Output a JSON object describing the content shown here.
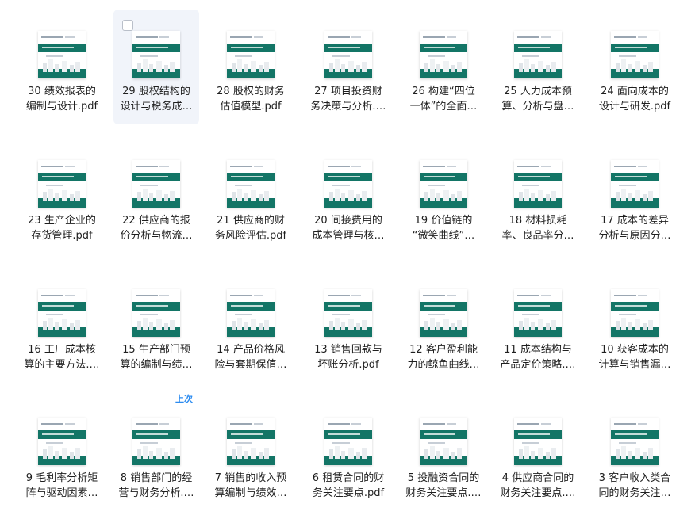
{
  "files": [
    {
      "line1": "30 绩效报表的",
      "line2": "编制与设计.pdf",
      "icon": "pdf-thumbnail-icon"
    },
    {
      "line1": "29 股权结构的",
      "line2": "设计与税务成…",
      "icon": "pdf-thumbnail-icon"
    },
    {
      "line1": "28 股权的财务",
      "line2": "估值模型.pdf",
      "icon": "pdf-thumbnail-icon"
    },
    {
      "line1": "27 项目投资财",
      "line2": "务决策与分析.…",
      "icon": "pdf-thumbnail-icon"
    },
    {
      "line1": "26 构建“四位",
      "line2": "一体”的全面…",
      "icon": "pdf-thumbnail-icon"
    },
    {
      "line1": "25 人力成本预",
      "line2": "算、分析与盘…",
      "icon": "pdf-thumbnail-icon"
    },
    {
      "line1": "24 面向成本的",
      "line2": "设计与研发.pdf",
      "icon": "pdf-thumbnail-icon"
    },
    {
      "line1": "23 生产企业的",
      "line2": "存货管理.pdf",
      "icon": "pdf-thumbnail-icon"
    },
    {
      "line1": "22 供应商的报",
      "line2": "价分析与物流…",
      "icon": "pdf-thumbnail-icon"
    },
    {
      "line1": "21 供应商的财",
      "line2": "务风险评估.pdf",
      "icon": "pdf-thumbnail-icon"
    },
    {
      "line1": "20 间接费用的",
      "line2": "成本管理与核…",
      "icon": "pdf-thumbnail-icon"
    },
    {
      "line1": "19 价值链的",
      "line2": "“微笑曲线”…",
      "icon": "pdf-thumbnail-icon"
    },
    {
      "line1": "18 材料损耗",
      "line2": "率、良品率分…",
      "icon": "pdf-thumbnail-icon"
    },
    {
      "line1": "17 成本的差异",
      "line2": "分析与原因分…",
      "icon": "pdf-thumbnail-icon"
    },
    {
      "line1": "16 工厂成本核",
      "line2": "算的主要方法.…",
      "icon": "pdf-thumbnail-icon"
    },
    {
      "line1": "15 生产部门预",
      "line2": "算的编制与绩…",
      "icon": "pdf-thumbnail-icon"
    },
    {
      "line1": "14 产品价格风",
      "line2": "险与套期保值…",
      "icon": "pdf-thumbnail-icon"
    },
    {
      "line1": "13 销售回款与",
      "line2": "坏账分析.pdf",
      "icon": "pdf-thumbnail-icon"
    },
    {
      "line1": "12 客户盈利能",
      "line2": "力的鲸鱼曲线…",
      "icon": "pdf-thumbnail-icon"
    },
    {
      "line1": "11 成本结构与",
      "line2": "产品定价策略.…",
      "icon": "pdf-thumbnail-icon"
    },
    {
      "line1": "10 获客成本的",
      "line2": "计算与销售漏…",
      "icon": "pdf-thumbnail-icon"
    },
    {
      "line1": "9 毛利率分析矩",
      "line2": "阵与驱动因素…",
      "icon": "pdf-thumbnail-icon"
    },
    {
      "line1": "8 销售部门的经",
      "line2": "营与财务分析.…",
      "icon": "pdf-thumbnail-icon"
    },
    {
      "line1": "7 销售的收入预",
      "line2": "算编制与绩效…",
      "icon": "pdf-thumbnail-icon"
    },
    {
      "line1": "6 租赁合同的财",
      "line2": "务关注要点.pdf",
      "icon": "pdf-thumbnail-icon"
    },
    {
      "line1": "5 投融资合同的",
      "line2": "财务关注要点.…",
      "icon": "pdf-thumbnail-icon"
    },
    {
      "line1": "4 供应商合同的",
      "line2": "财务关注要点.…",
      "icon": "pdf-thumbnail-icon"
    },
    {
      "line1": "3 客户收入类合",
      "line2": "同的财务关注…",
      "icon": "pdf-thumbnail-icon"
    }
  ],
  "recent_badge": "上次",
  "colors": {
    "band": "#137566",
    "text": "#1f1f1f",
    "badge": "#2d8cf0",
    "hover": "#f1f4fa"
  }
}
